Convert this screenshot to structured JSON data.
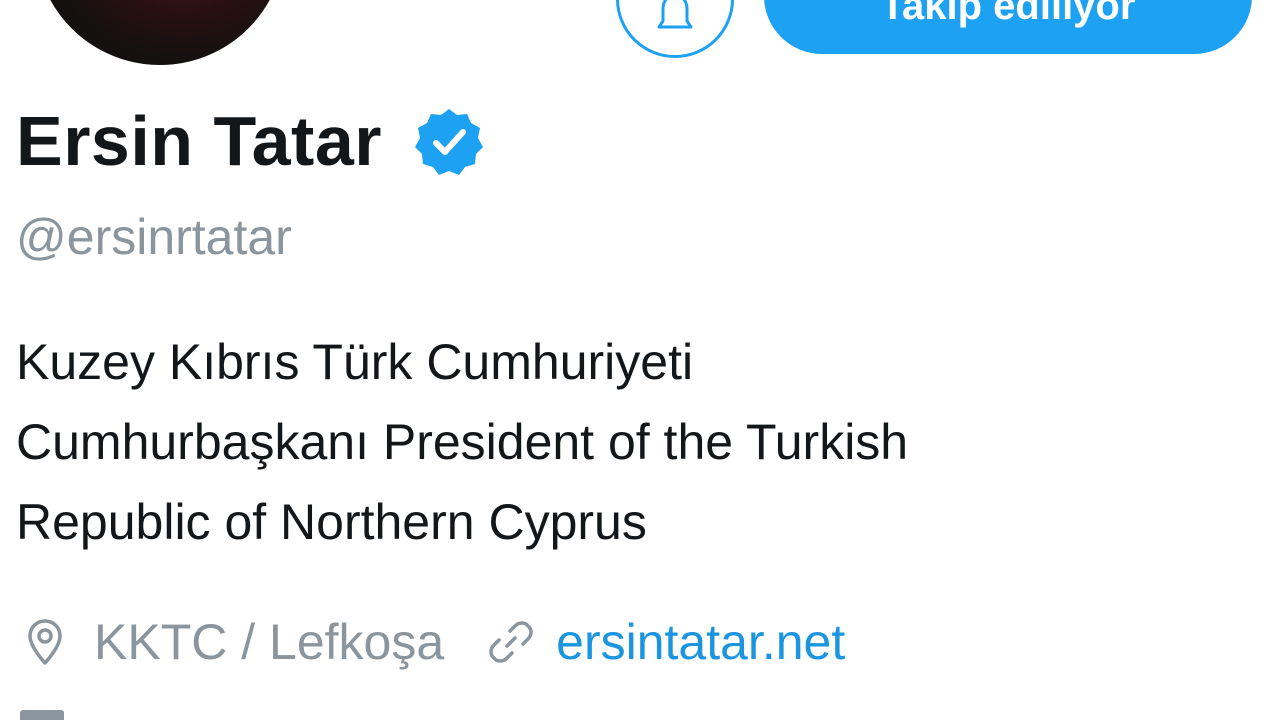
{
  "profile": {
    "display_name": "Ersin Tatar",
    "handle": "@ersinrtatar",
    "bio_lines": [
      "Kuzey Kıbrıs Türk Cumhuriyeti",
      "Cumhurbaşkanı President of the Turkish",
      "Republic of Northern Cyprus"
    ],
    "location": "KKTC  / Lefkoşa",
    "website": "ersintatar.net"
  },
  "actions": {
    "follow_label": "Takip ediliyor"
  },
  "icons": {
    "verified": "verified-badge-icon",
    "notifications": "bell-icon",
    "location": "location-pin-icon",
    "link": "link-icon",
    "joined": "calendar-icon"
  },
  "colors": {
    "accent": "#1da1f2",
    "link": "#1b95e0",
    "text": "#14171a",
    "secondary_text": "#8a959e"
  }
}
